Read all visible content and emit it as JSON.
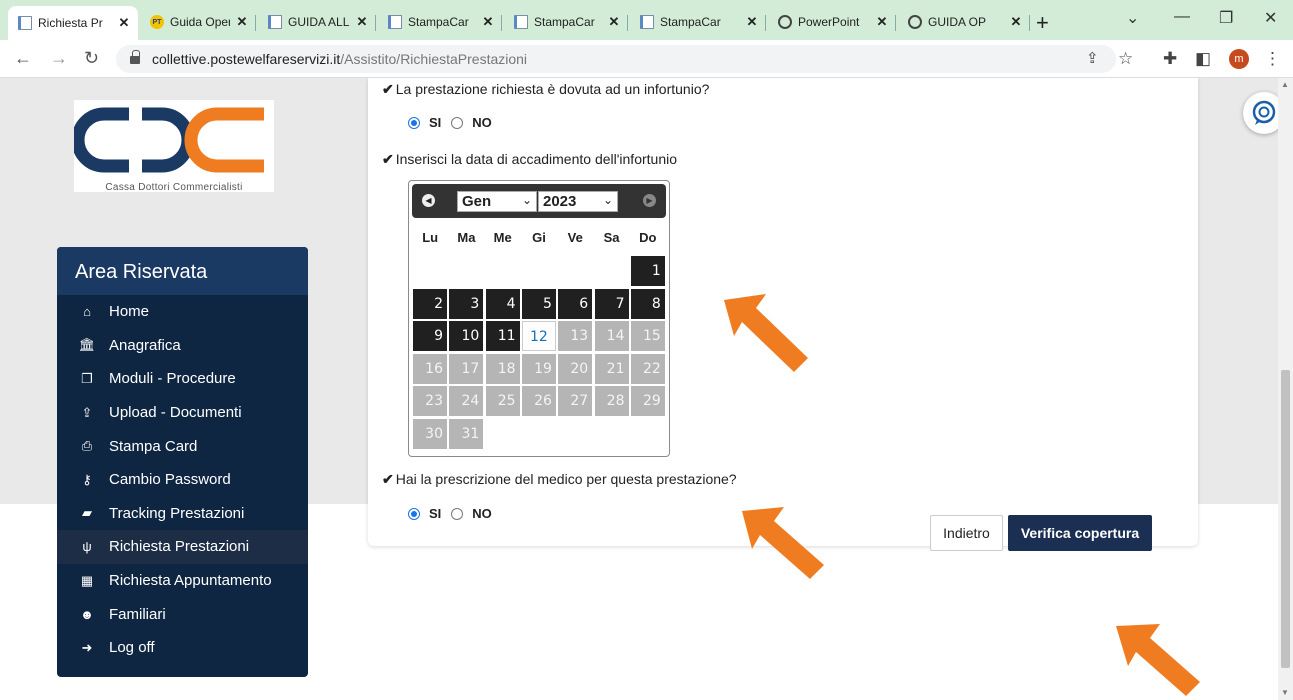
{
  "browser": {
    "tabs": [
      {
        "label": "Richiesta Pr",
        "icon": "document-icon",
        "active": true
      },
      {
        "label": "Guida Oper",
        "icon": "pt-logo-icon",
        "active": false
      },
      {
        "label": "GUIDA ALL",
        "icon": "document-icon",
        "active": false
      },
      {
        "label": "StampaCar",
        "icon": "document-icon",
        "active": false
      },
      {
        "label": "StampaCar",
        "icon": "document-icon",
        "active": false
      },
      {
        "label": "StampaCar",
        "icon": "document-icon",
        "active": false
      },
      {
        "label": "PowerPoint",
        "icon": "globe-icon",
        "active": false
      },
      {
        "label": "GUIDA OP",
        "icon": "globe-icon",
        "active": false
      }
    ],
    "new_tab": "+",
    "url_host": "collettive.postewelfareservizi.it",
    "url_path": "/Assistito/RichiestaPrestazioni",
    "profile_initial": "m"
  },
  "logo": {
    "caption": "Cassa Dottori Commercialisti"
  },
  "sidebar": {
    "title": "Area Riservata",
    "items": [
      {
        "label": "Home",
        "icon": "home-icon"
      },
      {
        "label": "Anagrafica",
        "icon": "bank-icon"
      },
      {
        "label": "Moduli - Procedure",
        "icon": "copy-icon"
      },
      {
        "label": "Upload - Documenti",
        "icon": "upload-icon"
      },
      {
        "label": "Stampa Card",
        "icon": "print-icon"
      },
      {
        "label": "Cambio Password",
        "icon": "key-icon"
      },
      {
        "label": "Tracking Prestazioni",
        "icon": "book-icon"
      },
      {
        "label": "Richiesta Prestazioni",
        "icon": "stethoscope-icon",
        "active": true
      },
      {
        "label": "Richiesta Appuntamento",
        "icon": "calendar-icon"
      },
      {
        "label": "Familiari",
        "icon": "users-icon"
      },
      {
        "label": "Log off",
        "icon": "sign-out-icon"
      }
    ]
  },
  "form": {
    "q_infortunio": "La prestazione richiesta è dovuta ad un infortunio?",
    "q_data": "Inserisci la data di accadimento dell'infortunio",
    "q_prescrizione": "Hai la prescrizione del medico per questa prestazione?",
    "yes_label": "SI",
    "no_label": "NO",
    "infortunio_selected": "SI",
    "prescrizione_selected": "SI"
  },
  "datepicker": {
    "month": "Gen",
    "year": "2023",
    "weekdays": [
      "Lu",
      "Ma",
      "Me",
      "Gi",
      "Ve",
      "Sa",
      "Do"
    ],
    "days_in_month": 31,
    "first_weekday_index": 6,
    "today": 12,
    "selectable_until": 11
  },
  "buttons": {
    "back": "Indietro",
    "verify": "Verifica copertura"
  },
  "colors": {
    "sidebar_bg": "#0f2643",
    "primary_button": "#1a2f52",
    "arrow": "#f07c22",
    "logo_blue": "#1a3a63",
    "logo_orange": "#f07c22"
  }
}
